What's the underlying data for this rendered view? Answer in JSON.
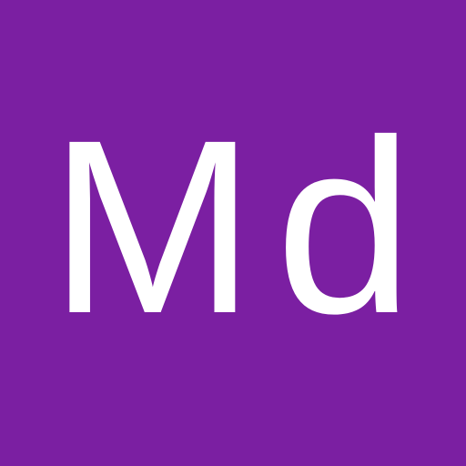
{
  "avatar": {
    "initials": "Md",
    "background_color": "#7B1FA2",
    "text_color": "#FFFFFF"
  }
}
